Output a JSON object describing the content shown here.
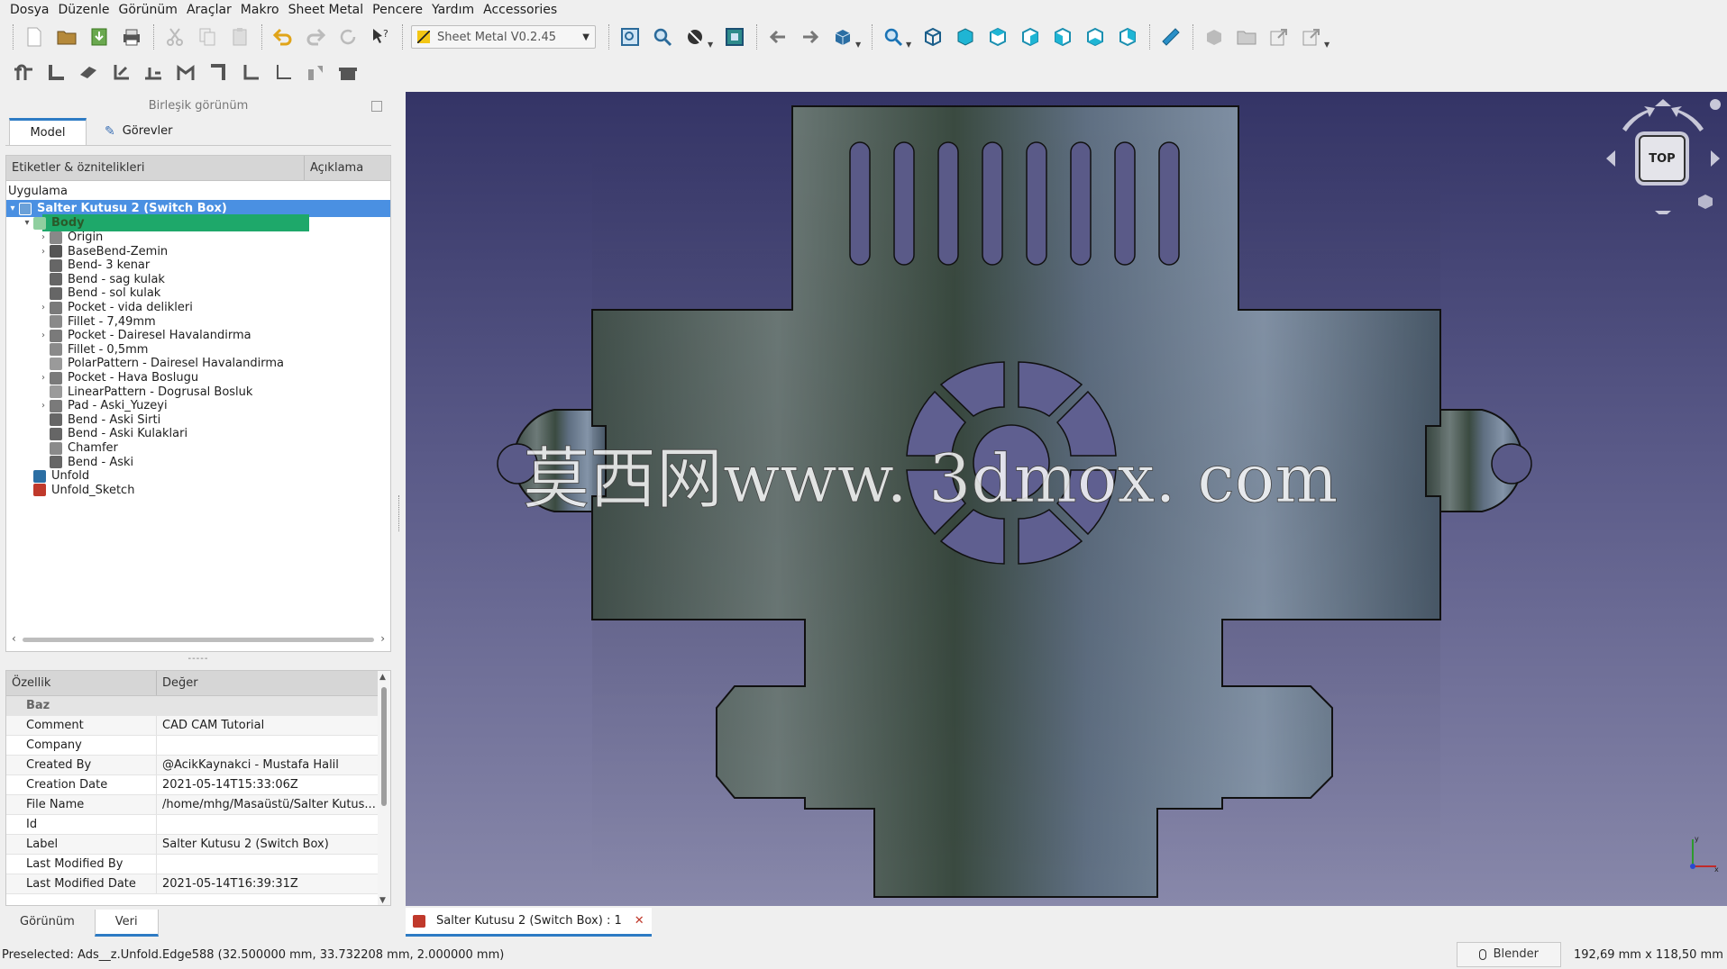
{
  "menubar": {
    "items": [
      "Dosya",
      "Düzenle",
      "Görünüm",
      "Araçlar",
      "Makro",
      "Sheet Metal",
      "Pencere",
      "Yardım",
      "Accessories"
    ]
  },
  "toolbar": {
    "workbench": "Sheet Metal V0.2.45"
  },
  "combo": {
    "title": "Birleşik görünüm",
    "tabs": [
      "Model",
      "Görevler"
    ]
  },
  "tree": {
    "header": {
      "labels": "Etiketler & öznitelikleri",
      "description": "Açıklama"
    },
    "section": "Uygulama",
    "root": "Salter Kutusu 2 (Switch Box)",
    "body": "Body",
    "items": [
      {
        "label": "Origin",
        "icon": "origin-icon",
        "expand": true
      },
      {
        "label": "BaseBend-Zemin",
        "icon": "base-bend-icon",
        "expand": true
      },
      {
        "label": "Bend- 3 kenar",
        "icon": "bend-icon",
        "expand": false
      },
      {
        "label": "Bend - sag kulak",
        "icon": "bend-icon",
        "expand": false
      },
      {
        "label": "Bend - sol kulak",
        "icon": "bend-icon",
        "expand": false
      },
      {
        "label": "Pocket - vida delikleri",
        "icon": "pocket-icon",
        "expand": true
      },
      {
        "label": "Fillet - 7,49mm",
        "icon": "fillet-icon",
        "expand": false
      },
      {
        "label": "Pocket - Dairesel Havalandirma",
        "icon": "pocket-icon",
        "expand": true
      },
      {
        "label": "Fillet - 0,5mm",
        "icon": "fillet-icon",
        "expand": false
      },
      {
        "label": "PolarPattern - Dairesel Havalandirma",
        "icon": "polar-pattern-icon",
        "expand": false
      },
      {
        "label": "Pocket - Hava Boslugu",
        "icon": "pocket-icon",
        "expand": true
      },
      {
        "label": "LinearPattern - Dogrusal Bosluk",
        "icon": "linear-pattern-icon",
        "expand": false
      },
      {
        "label": "Pad - Aski_Yuzeyi",
        "icon": "pad-icon",
        "expand": true
      },
      {
        "label": "Bend - Aski Sirti",
        "icon": "bend-icon",
        "expand": false
      },
      {
        "label": "Bend - Aski Kulaklari",
        "icon": "bend-icon",
        "expand": false
      },
      {
        "label": "Chamfer",
        "icon": "chamfer-icon",
        "expand": false
      },
      {
        "label": "Bend - Aski",
        "icon": "bend-icon",
        "expand": false
      }
    ],
    "bottom_items": [
      {
        "label": "Unfold",
        "icon": "unfold-icon"
      },
      {
        "label": "Unfold_Sketch",
        "icon": "sketch-icon"
      }
    ]
  },
  "splitter": "-----",
  "properties": {
    "header": {
      "property": "Özellik",
      "value": "Değer"
    },
    "group": "Baz",
    "rows": [
      {
        "name": "Comment",
        "value": "CAD CAM Tutorial"
      },
      {
        "name": "Company",
        "value": ""
      },
      {
        "name": "Created By",
        "value": "@AcikKaynakci - Mustafa Halil"
      },
      {
        "name": "Creation Date",
        "value": "2021-05-14T15:33:06Z"
      },
      {
        "name": "File Name",
        "value": "/home/mhg/Masaüstü/Salter Kutus..."
      },
      {
        "name": "Id",
        "value": ""
      },
      {
        "name": "Label",
        "value": "Salter Kutusu 2 (Switch Box)"
      },
      {
        "name": "Last Modified By",
        "value": ""
      },
      {
        "name": "Last Modified Date",
        "value": "2021-05-14T16:39:31Z"
      }
    ]
  },
  "bottom_tabs": [
    "Görünüm",
    "Veri"
  ],
  "viewport": {
    "doc_tab": "Salter Kutusu 2 (Switch Box) : 1",
    "navcube_face": "TOP",
    "watermark": "莫西网www. 3dmox. com"
  },
  "status": {
    "text": "Preselected: Ads__z.Unfold.Edge588 (32.500000 mm, 33.732208 mm, 2.000000 mm)",
    "nav_style": "Blender",
    "dimensions": "192,69 mm x 118,50 mm"
  },
  "colors": {
    "selection": "#4a90e2",
    "body_highlight": "#1ea86a",
    "accent_tab": "#2d7bc4",
    "viewport_top": "#343466",
    "viewport_bottom": "#8888aa"
  }
}
